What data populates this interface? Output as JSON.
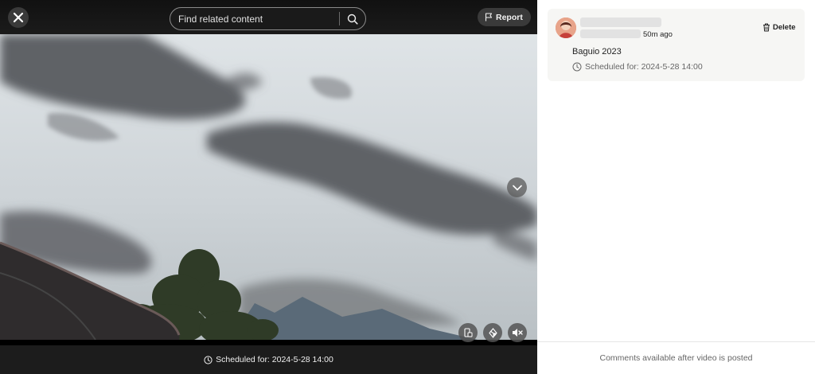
{
  "header": {
    "close_icon": "close-icon",
    "search": {
      "placeholder": "Find related content",
      "value": ""
    },
    "report_label": "Report"
  },
  "player": {
    "controls": [
      "screen-rotate-icon",
      "filter-icon",
      "mute-icon"
    ],
    "scheduled_text": "Scheduled for: 2024-5-28 14:00"
  },
  "post": {
    "time_ago": "50m ago",
    "delete_label": "Delete",
    "title": "Baguio 2023",
    "scheduled_text": "Scheduled for: 2024-5-28 14:00"
  },
  "comments": {
    "notice": "Comments available after video is posted"
  },
  "colors": {
    "bar_dark": "#1c1c1c",
    "button_dark": "#3a3a3a",
    "card_bg": "#f6f6f4",
    "muted_text": "#666666"
  }
}
